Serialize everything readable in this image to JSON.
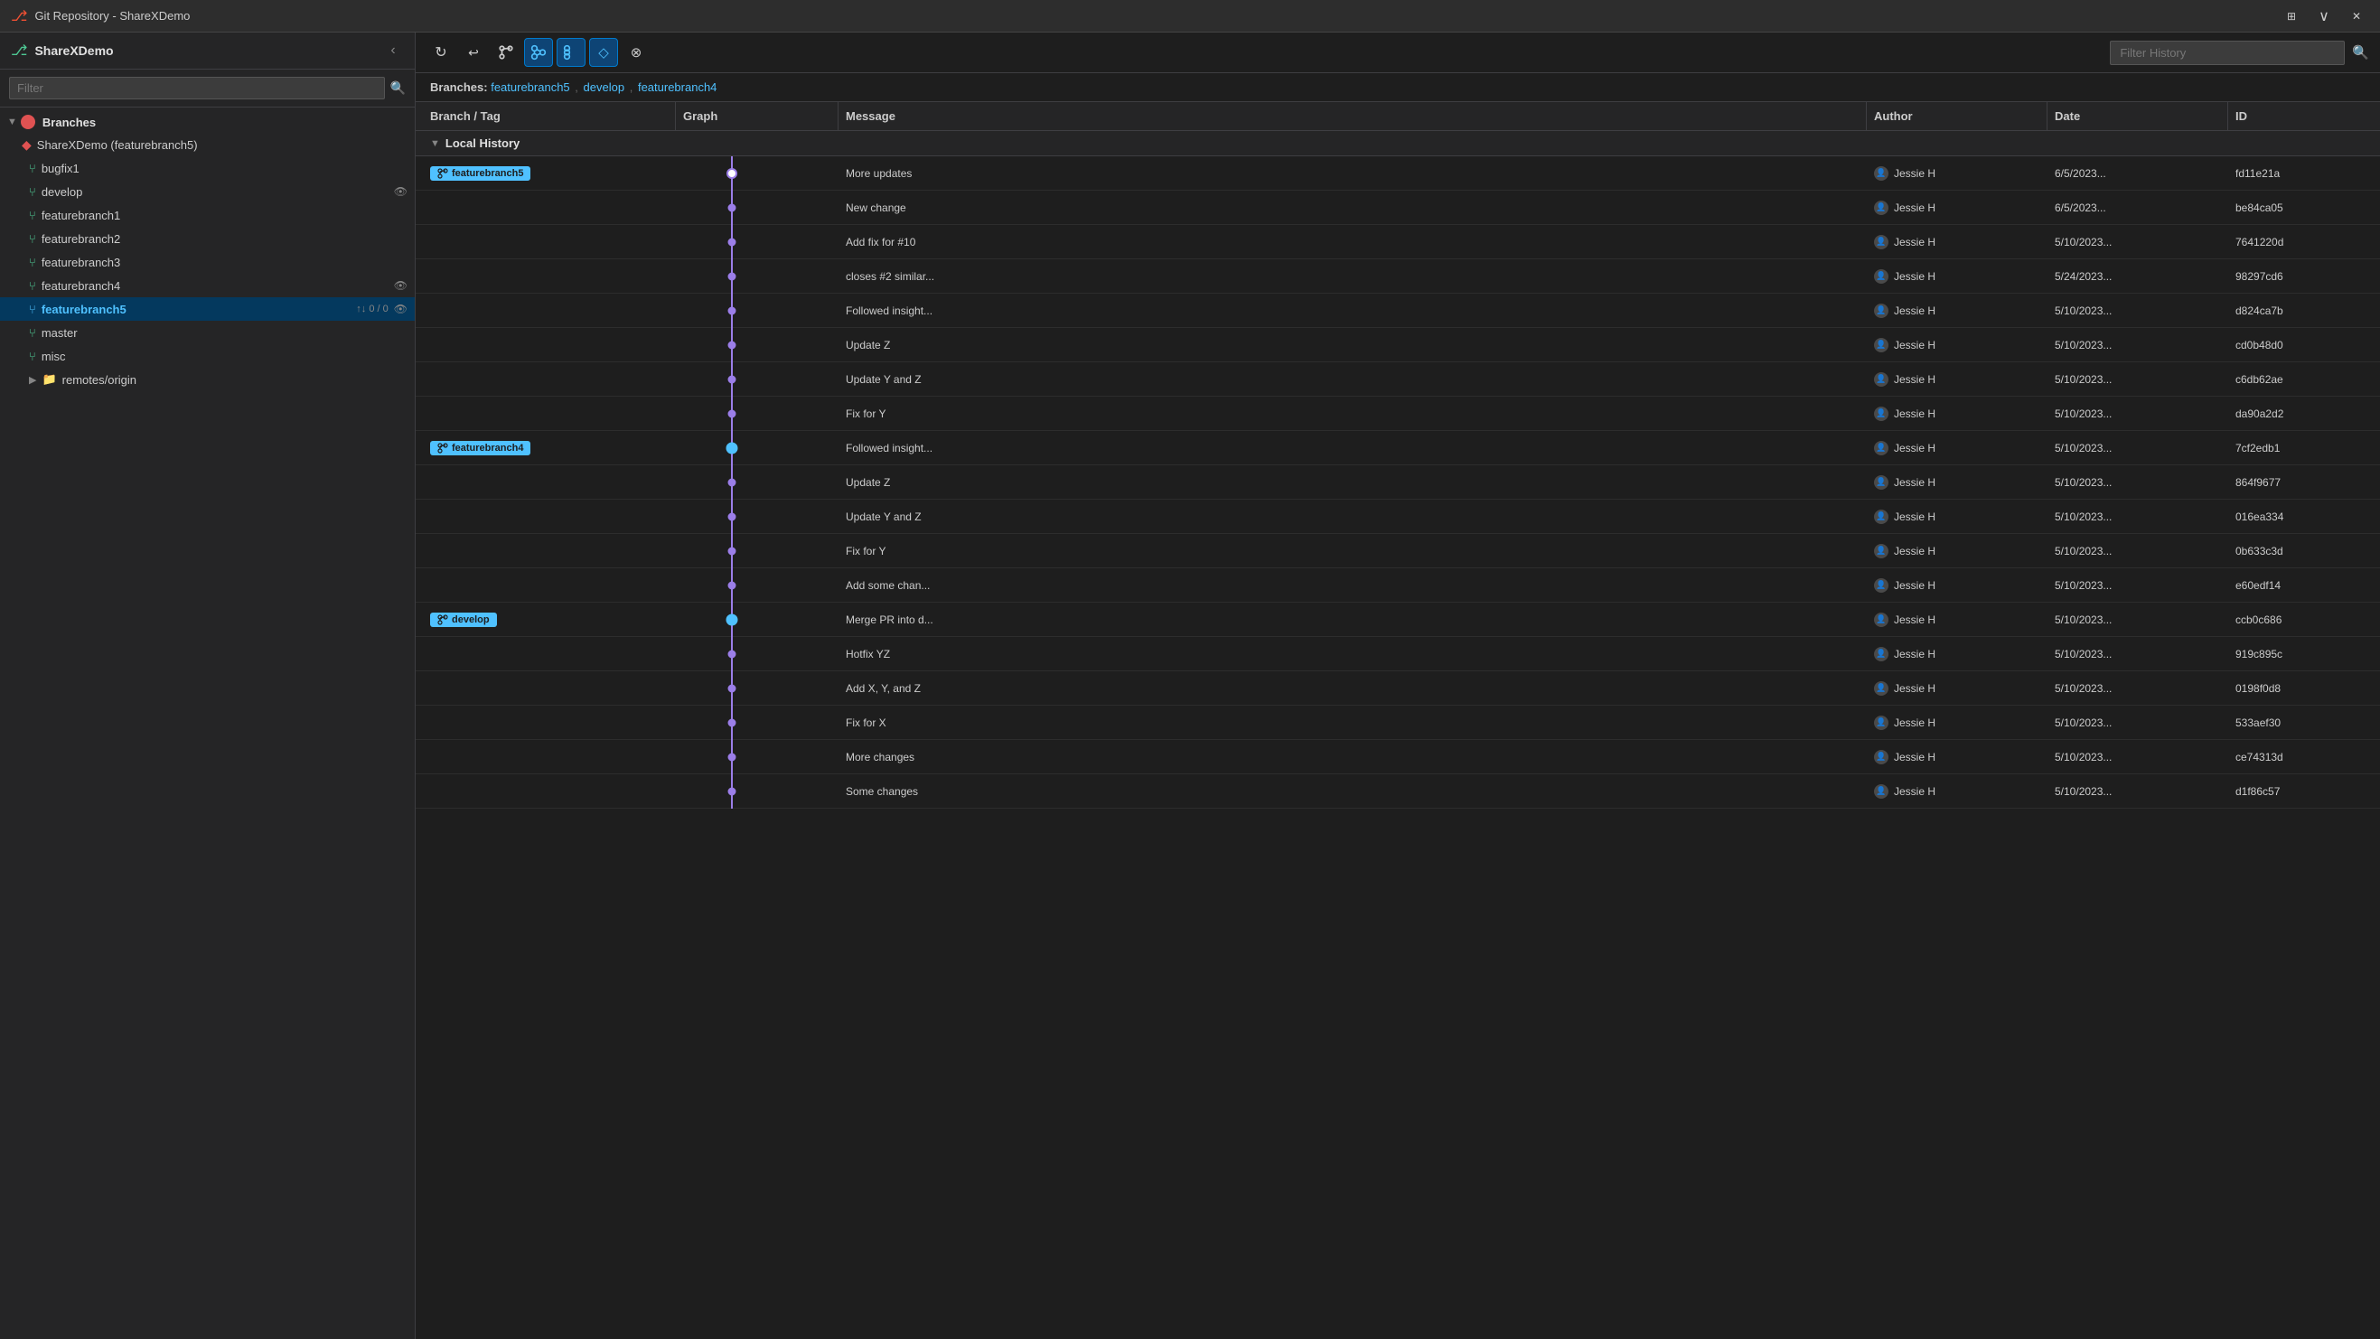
{
  "titleBar": {
    "title": "Git Repository - ShareXDemo",
    "pinBtn": "⊞",
    "closeBtn": "✕",
    "moreBtn": "∨"
  },
  "sidebar": {
    "title": "ShareXDemo",
    "filterPlaceholder": "Filter",
    "collapseBtn": "‹",
    "sections": [
      {
        "id": "branches",
        "label": "Branches",
        "expanded": true,
        "repoName": "ShareXDemo (featurebranch5)",
        "branches": [
          {
            "name": "bugfix1",
            "active": false,
            "badge": "",
            "watched": false
          },
          {
            "name": "develop",
            "active": false,
            "badge": "",
            "watched": true
          },
          {
            "name": "featurebranch1",
            "active": false,
            "badge": "",
            "watched": false
          },
          {
            "name": "featurebranch2",
            "active": false,
            "badge": "",
            "watched": false
          },
          {
            "name": "featurebranch3",
            "active": false,
            "badge": "",
            "watched": false
          },
          {
            "name": "featurebranch4",
            "active": false,
            "badge": "",
            "watched": true
          },
          {
            "name": "featurebranch5",
            "active": true,
            "badge": "↑↓ 0 / 0",
            "watched": true
          },
          {
            "name": "master",
            "active": false,
            "badge": "",
            "watched": false
          },
          {
            "name": "misc",
            "active": false,
            "badge": "",
            "watched": false
          }
        ],
        "remotes": [
          {
            "name": "remotes/origin",
            "expanded": false
          }
        ]
      }
    ]
  },
  "rightPanel": {
    "toolbar": {
      "buttons": [
        {
          "id": "refresh",
          "icon": "↻",
          "tooltip": "Refresh",
          "active": false
        },
        {
          "id": "undo",
          "icon": "↩",
          "tooltip": "Undo",
          "active": false
        },
        {
          "id": "branch-action",
          "icon": "⑂",
          "tooltip": "Branch action",
          "active": false
        },
        {
          "id": "graph-view",
          "icon": "⎇",
          "tooltip": "Graph view",
          "active": true
        },
        {
          "id": "list-view",
          "icon": "☰",
          "tooltip": "List view",
          "active": true
        },
        {
          "id": "tag",
          "icon": "◇",
          "tooltip": "Tag",
          "active": true
        },
        {
          "id": "filter",
          "icon": "⊗",
          "tooltip": "Filter",
          "active": false
        }
      ],
      "filterHistoryPlaceholder": "Filter History"
    },
    "branchesRow": {
      "label": "Branches:",
      "branches": [
        "featurebranch5",
        "develop",
        "featurebranch4"
      ]
    },
    "table": {
      "headers": [
        "Branch / Tag",
        "Graph",
        "Message",
        "Author",
        "Date",
        "ID"
      ],
      "localHistoryLabel": "Local History",
      "commits": [
        {
          "branchTag": "featurebranch5",
          "graphDot": "empty",
          "graphType": "top",
          "message": "More updates",
          "author": "Jessie H",
          "date": "6/5/2023...",
          "id": "fd11e21a",
          "dotColor": "#ffffff",
          "lineColor": "#9b7ee8"
        },
        {
          "branchTag": "",
          "graphType": "line",
          "message": "New change",
          "author": "Jessie H",
          "date": "6/5/2023...",
          "id": "be84ca05",
          "dotColor": "#9b7ee8",
          "lineColor": "#9b7ee8"
        },
        {
          "branchTag": "",
          "graphType": "line",
          "message": "Add fix for #10",
          "author": "Jessie H",
          "date": "5/10/2023...",
          "id": "7641220d",
          "dotColor": "#9b7ee8",
          "lineColor": "#9b7ee8"
        },
        {
          "branchTag": "",
          "graphType": "line",
          "message": "closes #2 similar...",
          "author": "Jessie H",
          "date": "5/24/2023...",
          "id": "98297cd6",
          "dotColor": "#9b7ee8",
          "lineColor": "#9b7ee8"
        },
        {
          "branchTag": "",
          "graphType": "line",
          "message": "Followed insight...",
          "author": "Jessie H",
          "date": "5/10/2023...",
          "id": "d824ca7b",
          "dotColor": "#9b7ee8",
          "lineColor": "#9b7ee8"
        },
        {
          "branchTag": "",
          "graphType": "line",
          "message": "Update Z",
          "author": "Jessie H",
          "date": "5/10/2023...",
          "id": "cd0b48d0",
          "dotColor": "#9b7ee8",
          "lineColor": "#9b7ee8"
        },
        {
          "branchTag": "",
          "graphType": "line",
          "message": "Update Y and Z",
          "author": "Jessie H",
          "date": "5/10/2023...",
          "id": "c6db62ae",
          "dotColor": "#9b7ee8",
          "lineColor": "#9b7ee8"
        },
        {
          "branchTag": "",
          "graphType": "line",
          "message": "Fix for Y",
          "author": "Jessie H",
          "date": "5/10/2023...",
          "id": "da90a2d2",
          "dotColor": "#9b7ee8",
          "lineColor": "#9b7ee8"
        },
        {
          "branchTag": "featurebranch4",
          "graphType": "merge",
          "message": "Followed insight...",
          "author": "Jessie H",
          "date": "5/10/2023...",
          "id": "7cf2edb1",
          "dotColor": "#4fc1ff",
          "lineColor": "#9b7ee8"
        },
        {
          "branchTag": "",
          "graphType": "line",
          "message": "Update Z",
          "author": "Jessie H",
          "date": "5/10/2023...",
          "id": "864f9677",
          "dotColor": "#9b7ee8",
          "lineColor": "#9b7ee8"
        },
        {
          "branchTag": "",
          "graphType": "line",
          "message": "Update Y and Z",
          "author": "Jessie H",
          "date": "5/10/2023...",
          "id": "016ea334",
          "dotColor": "#9b7ee8",
          "lineColor": "#9b7ee8"
        },
        {
          "branchTag": "",
          "graphType": "line",
          "message": "Fix for Y",
          "author": "Jessie H",
          "date": "5/10/2023...",
          "id": "0b633c3d",
          "dotColor": "#9b7ee8",
          "lineColor": "#9b7ee8"
        },
        {
          "branchTag": "",
          "graphType": "line",
          "message": "Add some chan...",
          "author": "Jessie H",
          "date": "5/10/2023...",
          "id": "e60edf14",
          "dotColor": "#9b7ee8",
          "lineColor": "#9b7ee8"
        },
        {
          "branchTag": "develop",
          "graphType": "merge",
          "message": "Merge PR into d...",
          "author": "Jessie H",
          "date": "5/10/2023...",
          "id": "ccb0c686",
          "dotColor": "#4fc1ff",
          "lineColor": "#9b7ee8"
        },
        {
          "branchTag": "",
          "graphType": "line",
          "message": "Hotfix YZ",
          "author": "Jessie H",
          "date": "5/10/2023...",
          "id": "919c895c",
          "dotColor": "#9b7ee8",
          "lineColor": "#9b7ee8"
        },
        {
          "branchTag": "",
          "graphType": "line",
          "message": "Add X, Y, and Z",
          "author": "Jessie H",
          "date": "5/10/2023...",
          "id": "0198f0d8",
          "dotColor": "#9b7ee8",
          "lineColor": "#9b7ee8"
        },
        {
          "branchTag": "",
          "graphType": "line",
          "message": "Fix for X",
          "author": "Jessie H",
          "date": "5/10/2023...",
          "id": "533aef30",
          "dotColor": "#9b7ee8",
          "lineColor": "#9b7ee8"
        },
        {
          "branchTag": "",
          "graphType": "line",
          "message": "More changes",
          "author": "Jessie H",
          "date": "5/10/2023...",
          "id": "ce74313d",
          "dotColor": "#9b7ee8",
          "lineColor": "#9b7ee8"
        },
        {
          "branchTag": "",
          "graphType": "line",
          "message": "Some changes",
          "author": "Jessie H",
          "date": "5/10/2023...",
          "id": "d1f86c57",
          "dotColor": "#9b7ee8",
          "lineColor": "#9b7ee8"
        }
      ]
    }
  }
}
